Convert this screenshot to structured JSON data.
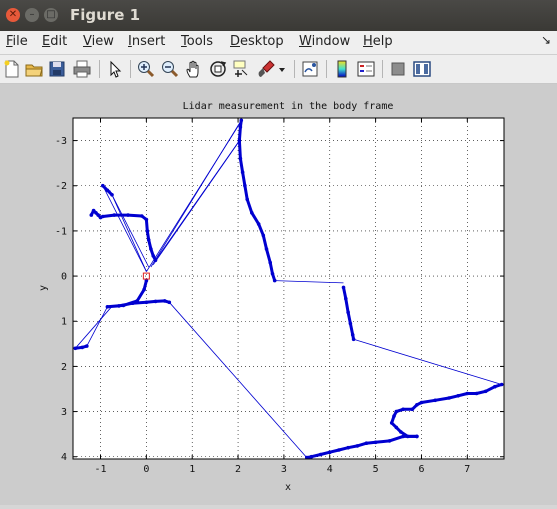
{
  "window": {
    "title": "Figure 1",
    "close_glyph": "✕",
    "min_glyph": "–",
    "max_glyph": "□"
  },
  "menubar": {
    "items": [
      {
        "ul": "F",
        "rest": "ile"
      },
      {
        "ul": "E",
        "rest": "dit"
      },
      {
        "ul": "V",
        "rest": "iew"
      },
      {
        "ul": "I",
        "rest": "nsert"
      },
      {
        "ul": "T",
        "rest": "ools"
      },
      {
        "ul": "D",
        "rest": "esktop"
      },
      {
        "ul": "W",
        "rest": "indow"
      },
      {
        "ul": "H",
        "rest": "elp"
      }
    ],
    "dock_glyph": "↘"
  },
  "toolbar": {
    "icons": [
      "new-figure-icon",
      "open-file-icon",
      "save-icon",
      "print-icon",
      "edit-plot-arrow-icon",
      "zoom-in-icon",
      "zoom-out-icon",
      "pan-hand-icon",
      "rotate-3d-icon",
      "data-cursor-icon",
      "brush-icon",
      "brush-dropdown-icon",
      "link-plot-icon",
      "colorbar-icon",
      "legend-icon",
      "hide-plot-tools-icon",
      "show-plot-tools-icon"
    ]
  },
  "chart_data": {
    "type": "scatter",
    "title": "Lidar measurement in the body frame",
    "xlabel": "x",
    "ylabel": "y",
    "xlim": [
      -1.6,
      7.8
    ],
    "ylim": [
      -3.5,
      4.05
    ],
    "y_reversed": true,
    "grid": "on",
    "xticks": [
      -1,
      0,
      1,
      2,
      3,
      4,
      5,
      6,
      7
    ],
    "yticks": [
      -3,
      -2,
      -1,
      0,
      1,
      2,
      3,
      4
    ],
    "series_color": "#0000d0",
    "origin_marker_color": "#e02020",
    "origin": [
      0,
      0
    ],
    "dense_segments": [
      [
        [
          -0.95,
          -2.0
        ],
        [
          -0.85,
          -1.9
        ],
        [
          -0.75,
          -1.8
        ]
      ],
      [
        [
          -1.2,
          -1.35
        ],
        [
          -1.15,
          -1.45
        ],
        [
          -1.1,
          -1.4
        ],
        [
          -1.05,
          -1.35
        ],
        [
          -1.0,
          -1.3
        ]
      ],
      [
        [
          -1.0,
          -1.3
        ],
        [
          -0.95,
          -1.32
        ],
        [
          -0.7,
          -1.35
        ],
        [
          -0.4,
          -1.35
        ],
        [
          -0.1,
          -1.33
        ],
        [
          0.0,
          -1.25
        ],
        [
          0.02,
          -1.0
        ],
        [
          0.05,
          -0.8
        ],
        [
          0.1,
          -0.6
        ],
        [
          0.15,
          -0.45
        ],
        [
          0.2,
          -0.35
        ]
      ],
      [
        [
          0.0,
          0.1
        ],
        [
          -0.05,
          0.3
        ],
        [
          -0.2,
          0.55
        ],
        [
          -0.5,
          0.65
        ],
        [
          -0.85,
          0.68
        ],
        [
          -0.6,
          0.66
        ],
        [
          -0.3,
          0.6
        ],
        [
          0.0,
          0.58
        ],
        [
          0.2,
          0.56
        ],
        [
          0.4,
          0.55
        ],
        [
          0.5,
          0.58
        ]
      ],
      [
        [
          -1.55,
          1.6
        ],
        [
          -1.4,
          1.58
        ],
        [
          -1.3,
          1.55
        ]
      ],
      [
        [
          2.07,
          -3.45
        ],
        [
          2.05,
          -3.3
        ],
        [
          2.03,
          -3.0
        ],
        [
          2.05,
          -2.6
        ],
        [
          2.1,
          -2.3
        ],
        [
          2.15,
          -2.0
        ],
        [
          2.2,
          -1.7
        ],
        [
          2.3,
          -1.4
        ],
        [
          2.45,
          -1.15
        ],
        [
          2.55,
          -0.9
        ],
        [
          2.62,
          -0.6
        ],
        [
          2.7,
          -0.3
        ],
        [
          2.75,
          -0.05
        ],
        [
          2.8,
          0.1
        ]
      ],
      [
        [
          4.3,
          0.25
        ],
        [
          4.35,
          0.5
        ],
        [
          4.4,
          0.8
        ],
        [
          4.45,
          1.05
        ],
        [
          4.5,
          1.3
        ],
        [
          4.52,
          1.4
        ]
      ],
      [
        [
          7.75,
          2.4
        ],
        [
          7.6,
          2.45
        ],
        [
          7.4,
          2.55
        ],
        [
          7.2,
          2.6
        ],
        [
          7.0,
          2.6
        ],
        [
          6.8,
          2.65
        ],
        [
          6.6,
          2.7
        ],
        [
          6.3,
          2.75
        ],
        [
          6.0,
          2.8
        ],
        [
          5.9,
          2.85
        ],
        [
          5.8,
          2.95
        ],
        [
          5.6,
          2.95
        ],
        [
          5.45,
          3.0
        ],
        [
          5.4,
          3.1
        ],
        [
          5.35,
          3.25
        ],
        [
          5.45,
          3.35
        ],
        [
          5.55,
          3.45
        ],
        [
          5.7,
          3.55
        ],
        [
          5.9,
          3.55
        ]
      ],
      [
        [
          5.9,
          3.55
        ],
        [
          5.6,
          3.55
        ],
        [
          5.3,
          3.65
        ],
        [
          5.0,
          3.68
        ],
        [
          4.8,
          3.7
        ],
        [
          4.6,
          3.76
        ],
        [
          4.4,
          3.8
        ],
        [
          4.2,
          3.85
        ],
        [
          4.0,
          3.9
        ],
        [
          3.8,
          3.95
        ],
        [
          3.6,
          4.0
        ],
        [
          3.5,
          4.02
        ]
      ]
    ],
    "thin_segments": [
      [
        [
          0.0,
          -0.1
        ],
        [
          -0.95,
          -2.0
        ]
      ],
      [
        [
          0.0,
          -0.1
        ],
        [
          -0.75,
          -1.8
        ]
      ],
      [
        [
          0.05,
          -0.2
        ],
        [
          -0.8,
          -1.9
        ]
      ],
      [
        [
          0.0,
          -0.1
        ],
        [
          2.05,
          -3.4
        ]
      ],
      [
        [
          0.1,
          -0.2
        ],
        [
          2.07,
          -3.45
        ]
      ],
      [
        [
          0.2,
          -0.35
        ],
        [
          2.03,
          -3.0
        ]
      ],
      [
        [
          0.15,
          -0.25
        ],
        [
          2.0,
          -2.95
        ]
      ],
      [
        [
          2.8,
          0.1
        ],
        [
          4.3,
          0.15
        ]
      ],
      [
        [
          4.52,
          1.4
        ],
        [
          7.75,
          2.4
        ]
      ],
      [
        [
          -0.85,
          0.68
        ],
        [
          -1.3,
          1.55
        ]
      ],
      [
        [
          0.5,
          0.58
        ],
        [
          3.5,
          4.02
        ]
      ],
      [
        [
          -0.75,
          0.67
        ],
        [
          -1.55,
          1.6
        ]
      ]
    ]
  }
}
